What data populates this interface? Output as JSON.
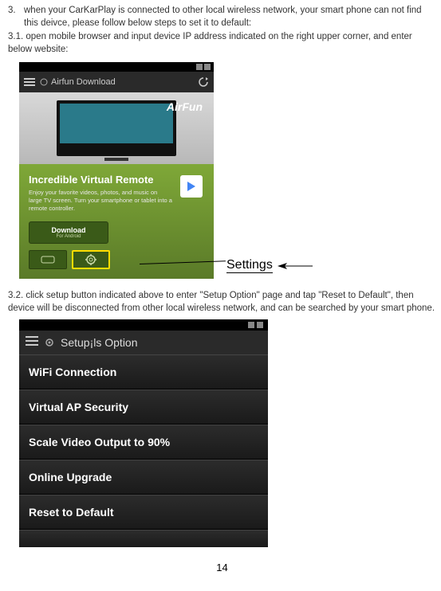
{
  "instructions": {
    "item3_num": "3.",
    "item3": "when your CarKarPlay is connected to other local wireless network, your smart phone can not find this deivce, please follow below steps to set it to default:",
    "item31": "3.1. open mobile browser and input device IP address indicated on the right upper corner, and enter below website:",
    "item32": "3.2. click setup button indicated above to enter \"Setup Option\" page and tap \"Reset to Default\", then device will be disconnected from other local wireless network, and can be searched by your smart phone."
  },
  "screenshot1": {
    "url_text": "Airfun Download",
    "logo": "AirFun",
    "headline": "Incredible Virtual Remote",
    "subtext": "Enjoy your favorite videos, photos, and music on large TV screen. Turn your smartphone or tablet into a remote controller.",
    "download_label": "Download",
    "download_sub": "For Android"
  },
  "callout": {
    "settings_label": "Settings"
  },
  "screenshot2": {
    "title": "Setup¡ls Option",
    "options": [
      "WiFi Connection",
      "Virtual AP Security",
      "Scale Video Output to 90%",
      "Online Upgrade",
      "Reset to Default"
    ]
  },
  "page_number": "14"
}
